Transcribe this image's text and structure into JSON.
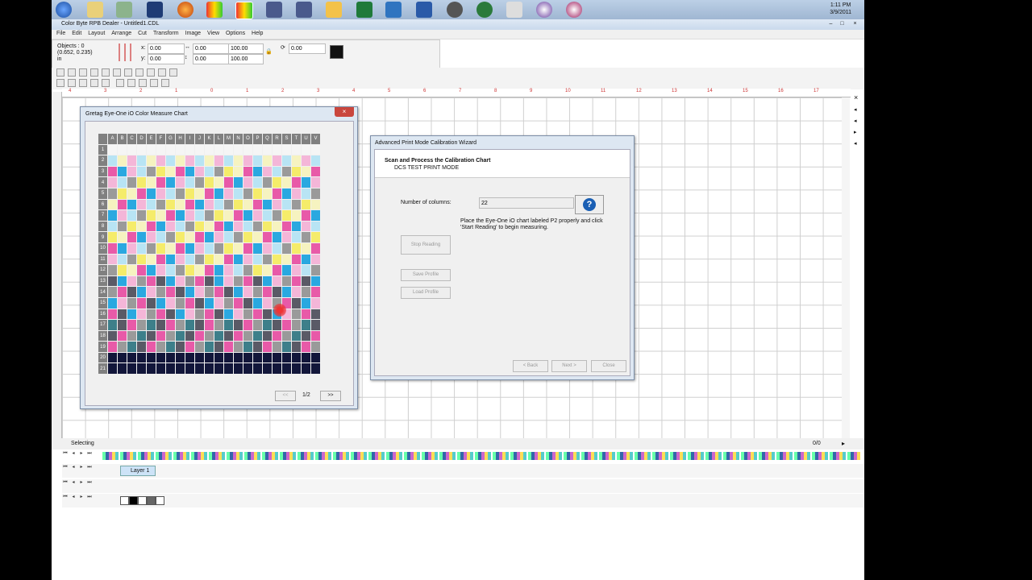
{
  "clock": {
    "time": "1:11 PM",
    "date": "3/9/2011"
  },
  "app": {
    "title": "Color Byte RPB Dealer - Untitled1.CDL",
    "menus": [
      "File",
      "Edit",
      "Layout",
      "Arrange",
      "Cut",
      "Transform",
      "Image",
      "View",
      "Options",
      "Help"
    ]
  },
  "props": {
    "objects": "Objects : 0",
    "coords": "(0.652, 0.235)",
    "unit": "in",
    "x_label": "x:",
    "x": "0.00",
    "y_label": "y:",
    "y": "0.00",
    "w": "0.00",
    "h": "0.00",
    "pw": "100.00",
    "ph": "100.00",
    "rot": "0.00"
  },
  "ruler_labels": [
    "4",
    "3",
    "2",
    "1",
    "0",
    "1",
    "2",
    "3",
    "4",
    "5",
    "6",
    "7",
    "8",
    "9",
    "10",
    "11",
    "12",
    "13",
    "14",
    "15",
    "16",
    "17"
  ],
  "status": {
    "mode": "Selecting",
    "page": "0/0"
  },
  "layers": {
    "layer1": "Layer 1"
  },
  "chart": {
    "title": "Gretag Eye-One iO Color Measure Chart",
    "columns": [
      "A",
      "B",
      "C",
      "D",
      "E",
      "F",
      "G",
      "H",
      "I",
      "J",
      "K",
      "L",
      "M",
      "N",
      "O",
      "P",
      "Q",
      "R",
      "S",
      "T",
      "U",
      "V"
    ],
    "rows": [
      "1",
      "2",
      "3",
      "4",
      "5",
      "6",
      "7",
      "8",
      "9",
      "10",
      "11",
      "12",
      "13",
      "14",
      "15",
      "16",
      "17",
      "18",
      "19",
      "20",
      "21"
    ],
    "prev": "<<",
    "page": "1/2",
    "next": ">>"
  },
  "wizard": {
    "title": "Advanced Print Mode Calibration Wizard",
    "heading": "Scan and Process the Calibration Chart",
    "subheading": "DCS TEST PRINT MODE",
    "columns_label": "Number of columns:",
    "columns_value": "22",
    "instructions": "Place the Eye-One iO chart labeled P2 properly and click",
    "instructions2": "'Start Reading' to begin measuring.",
    "stop": "Stop Reading",
    "save": "Save Profile",
    "load": "Load Profile",
    "back": "< Back",
    "next": "Next >",
    "close": "Close"
  },
  "colors": {
    "cyan": "#2aa8e0",
    "magenta": "#e85aa8",
    "yellow": "#f5ec6a",
    "pink": "#f4b6d8",
    "lightcyan": "#b8e4f4",
    "lightyellow": "#f6f3c0",
    "gray": "#9a9a9a",
    "dark": "#12163a",
    "teal": "#3d7f8a",
    "darkgray": "#5a5a66"
  }
}
